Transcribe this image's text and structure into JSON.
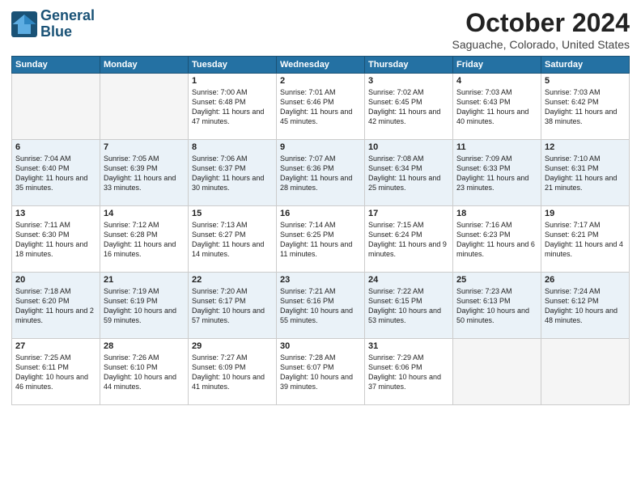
{
  "logo": {
    "line1": "General",
    "line2": "Blue"
  },
  "title": "October 2024",
  "location": "Saguache, Colorado, United States",
  "days_of_week": [
    "Sunday",
    "Monday",
    "Tuesday",
    "Wednesday",
    "Thursday",
    "Friday",
    "Saturday"
  ],
  "weeks": [
    [
      {
        "day": "",
        "info": ""
      },
      {
        "day": "",
        "info": ""
      },
      {
        "day": "1",
        "sunrise": "7:00 AM",
        "sunset": "6:48 PM",
        "daylight": "11 hours and 47 minutes."
      },
      {
        "day": "2",
        "sunrise": "7:01 AM",
        "sunset": "6:46 PM",
        "daylight": "11 hours and 45 minutes."
      },
      {
        "day": "3",
        "sunrise": "7:02 AM",
        "sunset": "6:45 PM",
        "daylight": "11 hours and 42 minutes."
      },
      {
        "day": "4",
        "sunrise": "7:03 AM",
        "sunset": "6:43 PM",
        "daylight": "11 hours and 40 minutes."
      },
      {
        "day": "5",
        "sunrise": "7:03 AM",
        "sunset": "6:42 PM",
        "daylight": "11 hours and 38 minutes."
      }
    ],
    [
      {
        "day": "6",
        "sunrise": "7:04 AM",
        "sunset": "6:40 PM",
        "daylight": "11 hours and 35 minutes."
      },
      {
        "day": "7",
        "sunrise": "7:05 AM",
        "sunset": "6:39 PM",
        "daylight": "11 hours and 33 minutes."
      },
      {
        "day": "8",
        "sunrise": "7:06 AM",
        "sunset": "6:37 PM",
        "daylight": "11 hours and 30 minutes."
      },
      {
        "day": "9",
        "sunrise": "7:07 AM",
        "sunset": "6:36 PM",
        "daylight": "11 hours and 28 minutes."
      },
      {
        "day": "10",
        "sunrise": "7:08 AM",
        "sunset": "6:34 PM",
        "daylight": "11 hours and 25 minutes."
      },
      {
        "day": "11",
        "sunrise": "7:09 AM",
        "sunset": "6:33 PM",
        "daylight": "11 hours and 23 minutes."
      },
      {
        "day": "12",
        "sunrise": "7:10 AM",
        "sunset": "6:31 PM",
        "daylight": "11 hours and 21 minutes."
      }
    ],
    [
      {
        "day": "13",
        "sunrise": "7:11 AM",
        "sunset": "6:30 PM",
        "daylight": "11 hours and 18 minutes."
      },
      {
        "day": "14",
        "sunrise": "7:12 AM",
        "sunset": "6:28 PM",
        "daylight": "11 hours and 16 minutes."
      },
      {
        "day": "15",
        "sunrise": "7:13 AM",
        "sunset": "6:27 PM",
        "daylight": "11 hours and 14 minutes."
      },
      {
        "day": "16",
        "sunrise": "7:14 AM",
        "sunset": "6:25 PM",
        "daylight": "11 hours and 11 minutes."
      },
      {
        "day": "17",
        "sunrise": "7:15 AM",
        "sunset": "6:24 PM",
        "daylight": "11 hours and 9 minutes."
      },
      {
        "day": "18",
        "sunrise": "7:16 AM",
        "sunset": "6:23 PM",
        "daylight": "11 hours and 6 minutes."
      },
      {
        "day": "19",
        "sunrise": "7:17 AM",
        "sunset": "6:21 PM",
        "daylight": "11 hours and 4 minutes."
      }
    ],
    [
      {
        "day": "20",
        "sunrise": "7:18 AM",
        "sunset": "6:20 PM",
        "daylight": "11 hours and 2 minutes."
      },
      {
        "day": "21",
        "sunrise": "7:19 AM",
        "sunset": "6:19 PM",
        "daylight": "10 hours and 59 minutes."
      },
      {
        "day": "22",
        "sunrise": "7:20 AM",
        "sunset": "6:17 PM",
        "daylight": "10 hours and 57 minutes."
      },
      {
        "day": "23",
        "sunrise": "7:21 AM",
        "sunset": "6:16 PM",
        "daylight": "10 hours and 55 minutes."
      },
      {
        "day": "24",
        "sunrise": "7:22 AM",
        "sunset": "6:15 PM",
        "daylight": "10 hours and 53 minutes."
      },
      {
        "day": "25",
        "sunrise": "7:23 AM",
        "sunset": "6:13 PM",
        "daylight": "10 hours and 50 minutes."
      },
      {
        "day": "26",
        "sunrise": "7:24 AM",
        "sunset": "6:12 PM",
        "daylight": "10 hours and 48 minutes."
      }
    ],
    [
      {
        "day": "27",
        "sunrise": "7:25 AM",
        "sunset": "6:11 PM",
        "daylight": "10 hours and 46 minutes."
      },
      {
        "day": "28",
        "sunrise": "7:26 AM",
        "sunset": "6:10 PM",
        "daylight": "10 hours and 44 minutes."
      },
      {
        "day": "29",
        "sunrise": "7:27 AM",
        "sunset": "6:09 PM",
        "daylight": "10 hours and 41 minutes."
      },
      {
        "day": "30",
        "sunrise": "7:28 AM",
        "sunset": "6:07 PM",
        "daylight": "10 hours and 39 minutes."
      },
      {
        "day": "31",
        "sunrise": "7:29 AM",
        "sunset": "6:06 PM",
        "daylight": "10 hours and 37 minutes."
      },
      {
        "day": "",
        "info": ""
      },
      {
        "day": "",
        "info": ""
      }
    ]
  ]
}
